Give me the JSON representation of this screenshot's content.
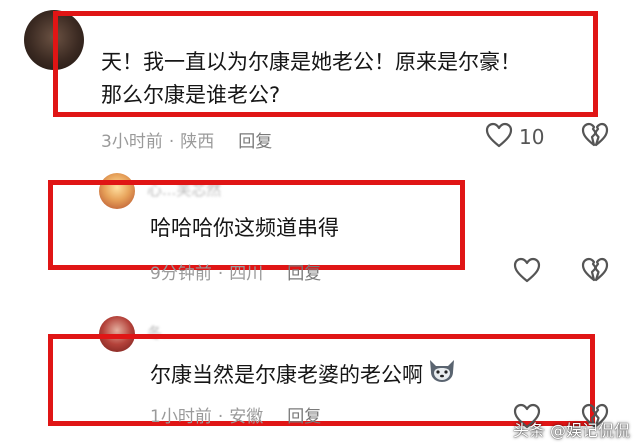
{
  "comments": [
    {
      "username": "",
      "text_line1": "天！我一直以为尔康是她老公！原来是尔豪！",
      "text_line2": "那么尔康是谁老公?",
      "time": "3小时前",
      "separator": "·",
      "location": "陕西",
      "reply_label": "回复",
      "like_count": "10"
    },
    {
      "username": "心...芙芯然",
      "text": "哈哈哈你这频道串得",
      "time": "9分钟前",
      "separator": "·",
      "location": "四川",
      "reply_label": "回复"
    },
    {
      "username": "冬...",
      "text": "尔康当然是尔康老婆的老公啊",
      "time": "1小时前",
      "separator": "·",
      "location": "安徽",
      "reply_label": "回复"
    }
  ],
  "icons": {
    "like": "heart-outline-icon",
    "dislike": "broken-heart-icon",
    "emoji": "wolf-emoji-icon"
  },
  "colors": {
    "highlight_box": "#e01515",
    "meta_text": "#9a9a9a"
  },
  "watermark": "头条 @娱记侃侃"
}
